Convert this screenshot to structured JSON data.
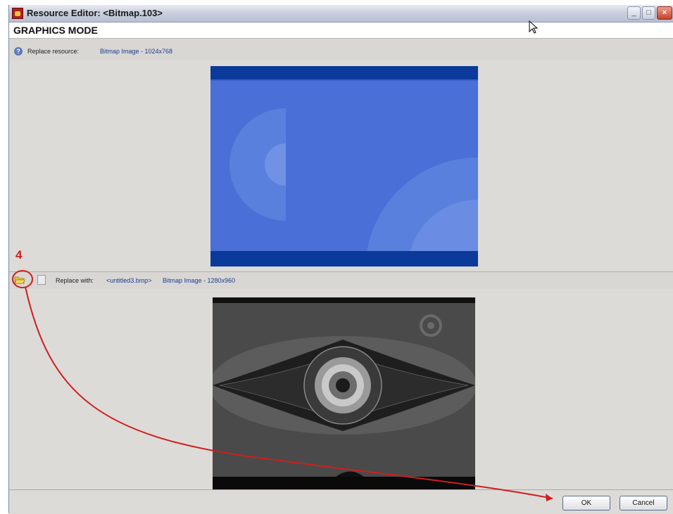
{
  "window": {
    "title": "Resource Editor: <Bitmap.103>",
    "minimize_icon": "minimize-icon",
    "maximize_icon": "maximize-icon",
    "close_icon": "close-icon"
  },
  "mode_label": "GRAPHICS MODE",
  "resource_row": {
    "label": "Replace resource:",
    "value": "Bitmap Image - 1024x768",
    "icon": "help-icon"
  },
  "replace_row": {
    "label": "Replace with:",
    "file": "<untitled3.bmp>",
    "value": "Bitmap Image - 1280x960",
    "open_icon": "folder-open-icon",
    "copy_icon": "copy-icon"
  },
  "annotation": {
    "step": "4",
    "color": "#d01e1e"
  },
  "buttons": {
    "ok": "OK",
    "cancel": "Cancel"
  },
  "colors": {
    "preview_blue": "#4a6fd6",
    "preview_band": "#0b3a9a",
    "title_text": "#1a1a1a",
    "link_text": "#1f3b8f"
  }
}
